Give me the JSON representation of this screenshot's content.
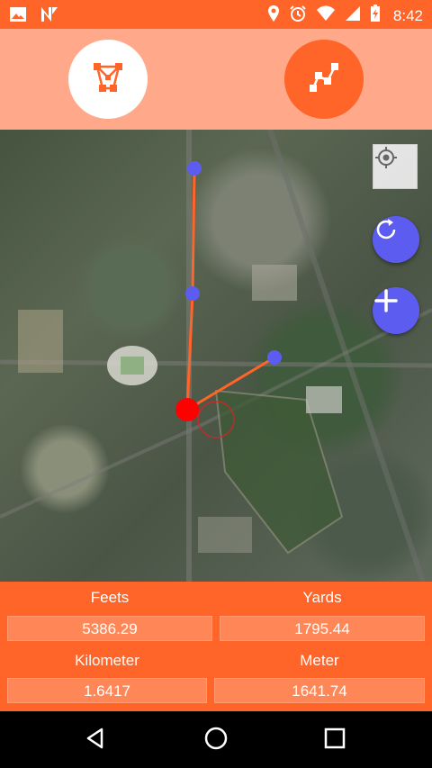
{
  "status_bar": {
    "time": "8:42",
    "icons": [
      "image-icon",
      "n-app-icon",
      "location-pin-icon",
      "alarm-icon",
      "wifi-icon",
      "signal-icon",
      "battery-charging-icon"
    ]
  },
  "toolbar": {
    "area_mode_icon": "polygon-area-icon",
    "distance_mode_icon": "polyline-distance-icon"
  },
  "map": {
    "controls": [
      "my-location-icon",
      "refresh-icon",
      "add-icon"
    ]
  },
  "results": {
    "feets_label": "Feets",
    "feets_value": "5386.29",
    "yards_label": "Yards",
    "yards_value": "1795.44",
    "kilometer_label": "Kilometer",
    "kilometer_value": "1.6417",
    "meter_label": "Meter",
    "meter_value": "1641.74"
  },
  "colors": {
    "accent": "#FF6428",
    "toolbar": "#FFA98A",
    "fab": "#5C5CF0",
    "marker": "#5C5CF0",
    "current": "#FF0000"
  },
  "nav_bar": {
    "icons": [
      "back-icon",
      "home-icon",
      "recents-icon"
    ]
  }
}
